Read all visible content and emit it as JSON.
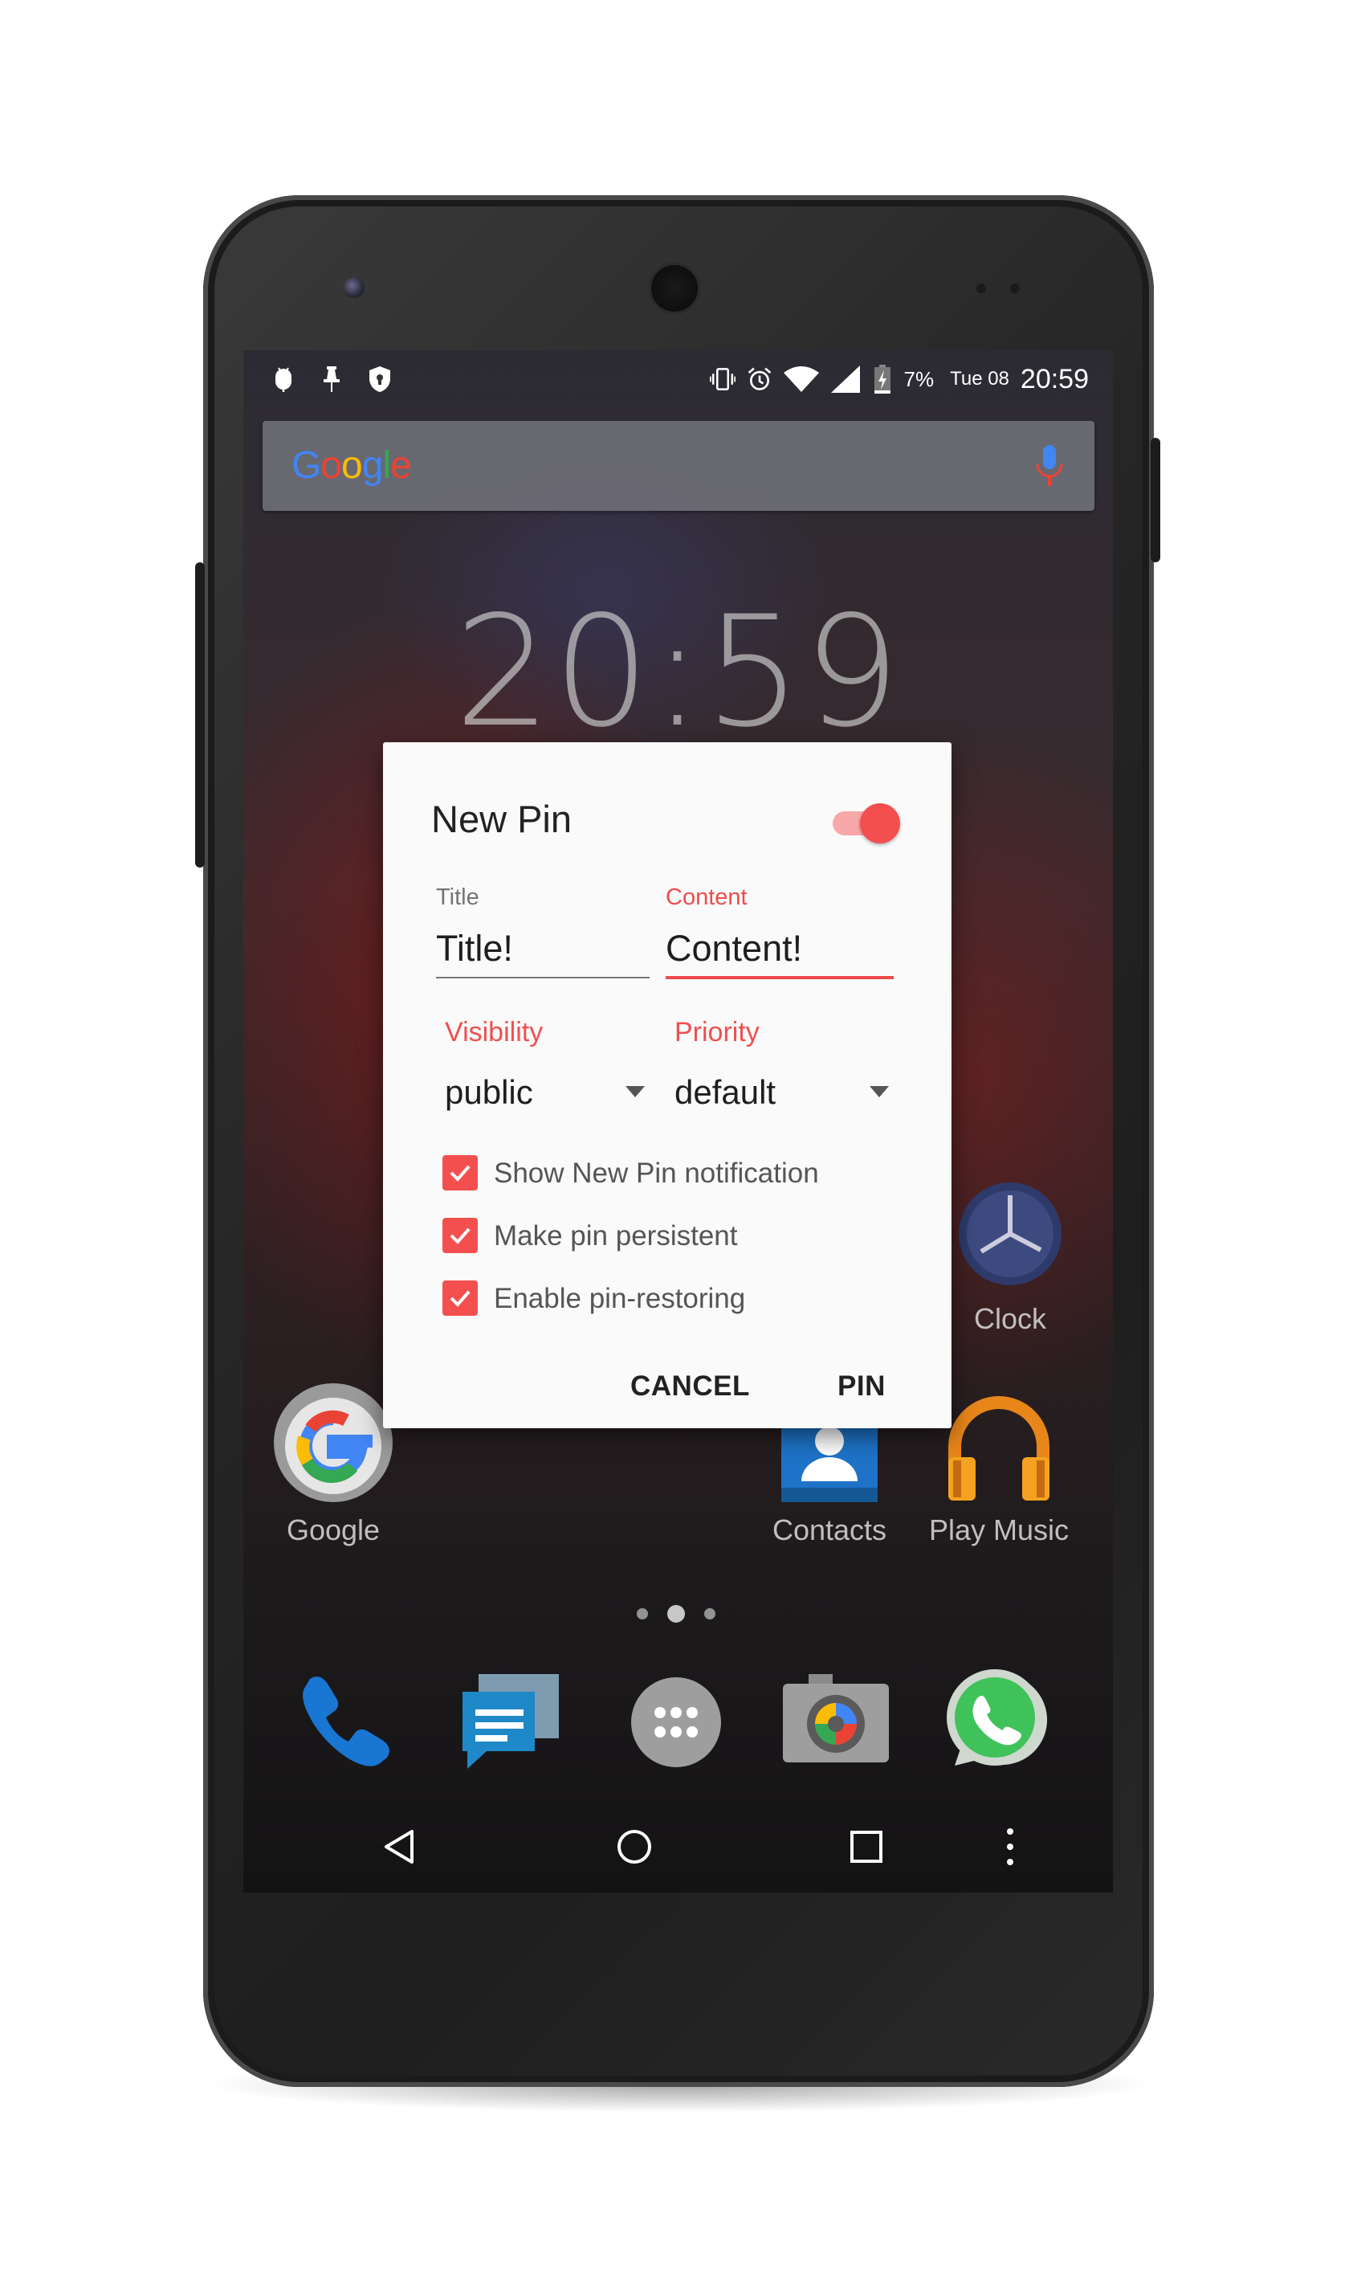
{
  "status_bar": {
    "battery_percent": "7%",
    "date": "Tue 08",
    "time": "20:59",
    "left_icons": [
      "android-debug-icon",
      "pin-icon",
      "shield-icon"
    ],
    "right_icons": [
      "vibrate-icon",
      "alarm-icon",
      "wifi-icon",
      "signal-icon",
      "battery-charging-icon"
    ]
  },
  "search": {
    "logo": "Google",
    "logo_colors": [
      "#4285f4",
      "#ea4335",
      "#fbbc05",
      "#4285f4",
      "#34a853",
      "#ea4335"
    ]
  },
  "homescreen": {
    "clock": "20:59",
    "apps": [
      {
        "label": "Clock",
        "icon": "clock-icon"
      },
      {
        "label": "Google",
        "icon": "google-icon"
      },
      {
        "label": "Contacts",
        "icon": "contacts-icon"
      },
      {
        "label": "Play Music",
        "icon": "headphones-icon"
      }
    ],
    "dock": [
      "phone-icon",
      "messages-icon",
      "app-drawer-icon",
      "camera-icon",
      "whatsapp-icon"
    ],
    "page_indicator": {
      "count": 3,
      "active": 1
    }
  },
  "dialog": {
    "title": "New Pin",
    "toggle_on": true,
    "title_field": {
      "label": "Title",
      "value": "Title!"
    },
    "content_field": {
      "label": "Content",
      "value": "Content!"
    },
    "visibility": {
      "label": "Visibility",
      "value": "public"
    },
    "priority": {
      "label": "Priority",
      "value": "default"
    },
    "checkboxes": [
      {
        "label": "Show New Pin notification",
        "checked": true
      },
      {
        "label": "Make pin persistent",
        "checked": true
      },
      {
        "label": "Enable pin-restoring",
        "checked": true
      }
    ],
    "cancel_label": "CANCEL",
    "pin_label": "PIN"
  },
  "colors": {
    "accent": "#f44f4f",
    "accent_light": "#f7a8a8",
    "dialog_bg": "#fafafa"
  }
}
